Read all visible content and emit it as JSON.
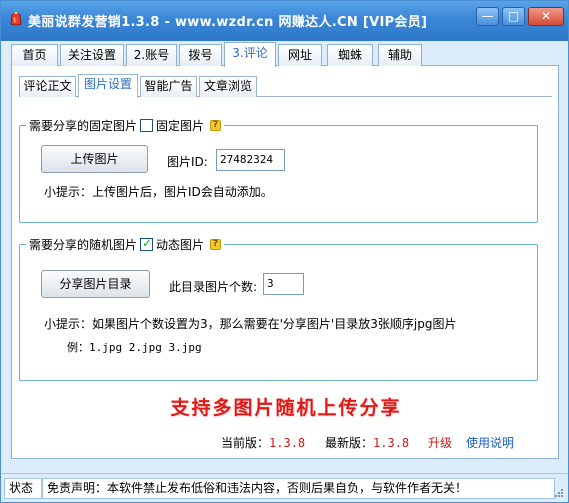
{
  "window": {
    "title": "美丽说群发营销1.3.8 - www.wzdr.cn 网赚达人.CN [VIP会员]",
    "minimize_glyph": "—",
    "maximize_glyph": "□",
    "close_glyph": "✕"
  },
  "main_tabs": [
    "首页",
    "关注设置",
    "2.账号",
    "拨号",
    "3.评论",
    "网址",
    "蜘蛛",
    "辅助"
  ],
  "active_main_tab": "3.评论",
  "sub_tabs": [
    "评论正文",
    "图片设置",
    "智能广告",
    "文章浏览"
  ],
  "active_sub_tab": "图片设置",
  "fixed_group": {
    "legend": "需要分享的固定图片",
    "checkbox_label": "固定图片",
    "checked": false,
    "upload_button": "上传图片",
    "id_label": "图片ID:",
    "id_value": "27482324",
    "tip": "小提示：上传图片后，图片ID会自动添加。"
  },
  "random_group": {
    "legend": "需要分享的随机图片",
    "checkbox_label": "动态图片",
    "checked": true,
    "dir_button": "分享图片目录",
    "count_label": "此目录图片个数:",
    "count_value": "3",
    "tip": "小提示：如果图片个数设置为3，那么需要在'分享图片'目录放3张顺序jpg图片",
    "example": "例：1.jpg 2.jpg 3.jpg"
  },
  "promo_text": "支持多图片随机上传分享",
  "footer": {
    "current_label": "当前版：",
    "current_version": "1.3.8",
    "latest_label": "最新版：",
    "latest_version": "1.3.8",
    "upgrade_link": "升级",
    "help_link": "使用说明"
  },
  "statusbar": {
    "status_label": "状态",
    "disclaimer": "免责声明：本软件禁止发布低俗和违法内容，否则后果自负，与软件作者无关！"
  },
  "colors": {
    "titlebar": "#3a86d6",
    "window_bg": "#dcecfb",
    "promo": "#e01818",
    "active_tab_text": "#2b6cc4",
    "version_red": "#d01818",
    "link_blue": "#1a5ec8",
    "group_border": "#6ab0c8"
  },
  "icons": [
    "app-icon",
    "help-icon",
    "size-grip-icon"
  ]
}
